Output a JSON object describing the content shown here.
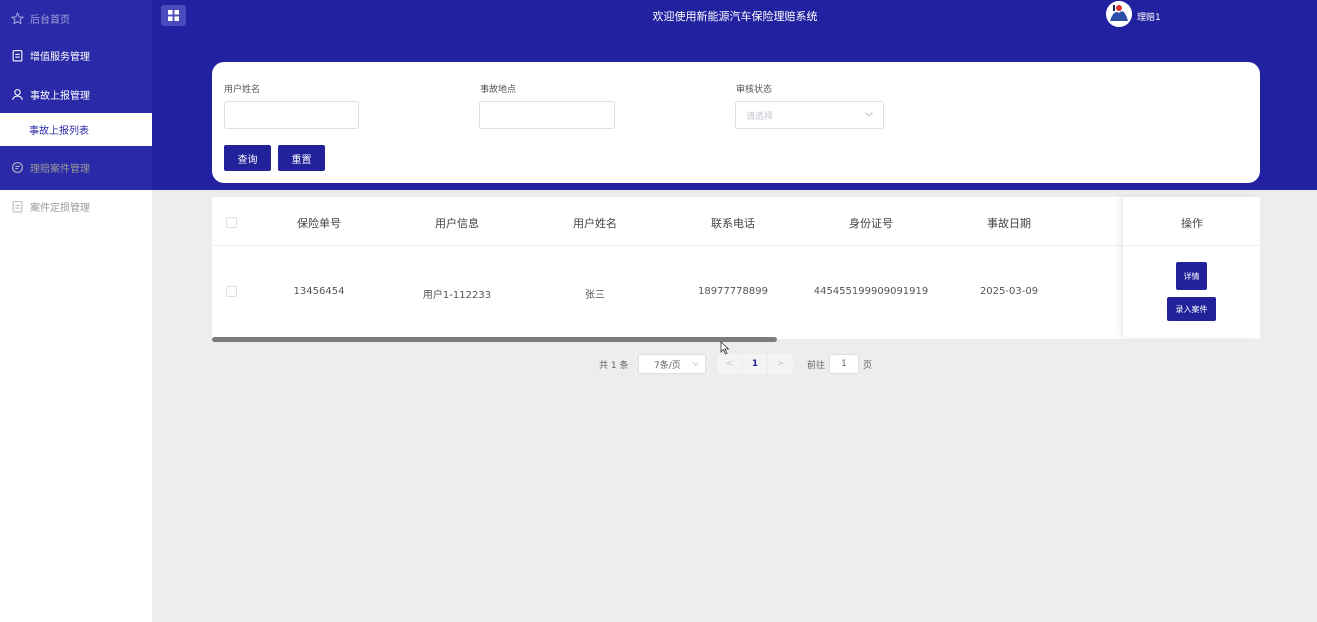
{
  "sidebar": {
    "items": [
      {
        "label": "后台首页",
        "icon": "star-icon"
      },
      {
        "label": "增值服务管理",
        "icon": "clipboard-icon"
      },
      {
        "label": "事故上报管理",
        "icon": "user-icon"
      },
      {
        "label": "事故上报列表"
      },
      {
        "label": "理赔案件管理",
        "icon": "chat-icon"
      },
      {
        "label": "案件定损管理",
        "icon": "clipboard-icon"
      }
    ]
  },
  "header": {
    "title": "欢迎使用新能源汽车保险理赔系统",
    "user": "理赔1"
  },
  "search": {
    "fields": [
      {
        "label": "用户姓名",
        "value": ""
      },
      {
        "label": "事故地点",
        "value": ""
      },
      {
        "label": "审核状态",
        "placeholder": "请选择"
      }
    ],
    "query_label": "查询",
    "reset_label": "重置"
  },
  "table": {
    "columns": [
      "保险单号",
      "用户信息",
      "用户姓名",
      "联系电话",
      "身份证号",
      "事故日期",
      "操作"
    ],
    "rows": [
      {
        "policy_no": "13456454",
        "user_info": "用户1-112233",
        "user_name": "张三",
        "phone": "18977778899",
        "id_no": "445455199909091919",
        "date": "2025-03-09",
        "actions": [
          "详情",
          "录入案件"
        ]
      }
    ]
  },
  "pagination": {
    "total": "共 1 条",
    "page_size": "7条/页",
    "prev": "<",
    "current_page": "1",
    "next": ">",
    "goto_prefix": "前往",
    "goto_value": "1",
    "goto_suffix": "页"
  },
  "colors": {
    "primary": "#22229a",
    "header_bg": "#2222a0",
    "content_bg": "#ededed"
  }
}
